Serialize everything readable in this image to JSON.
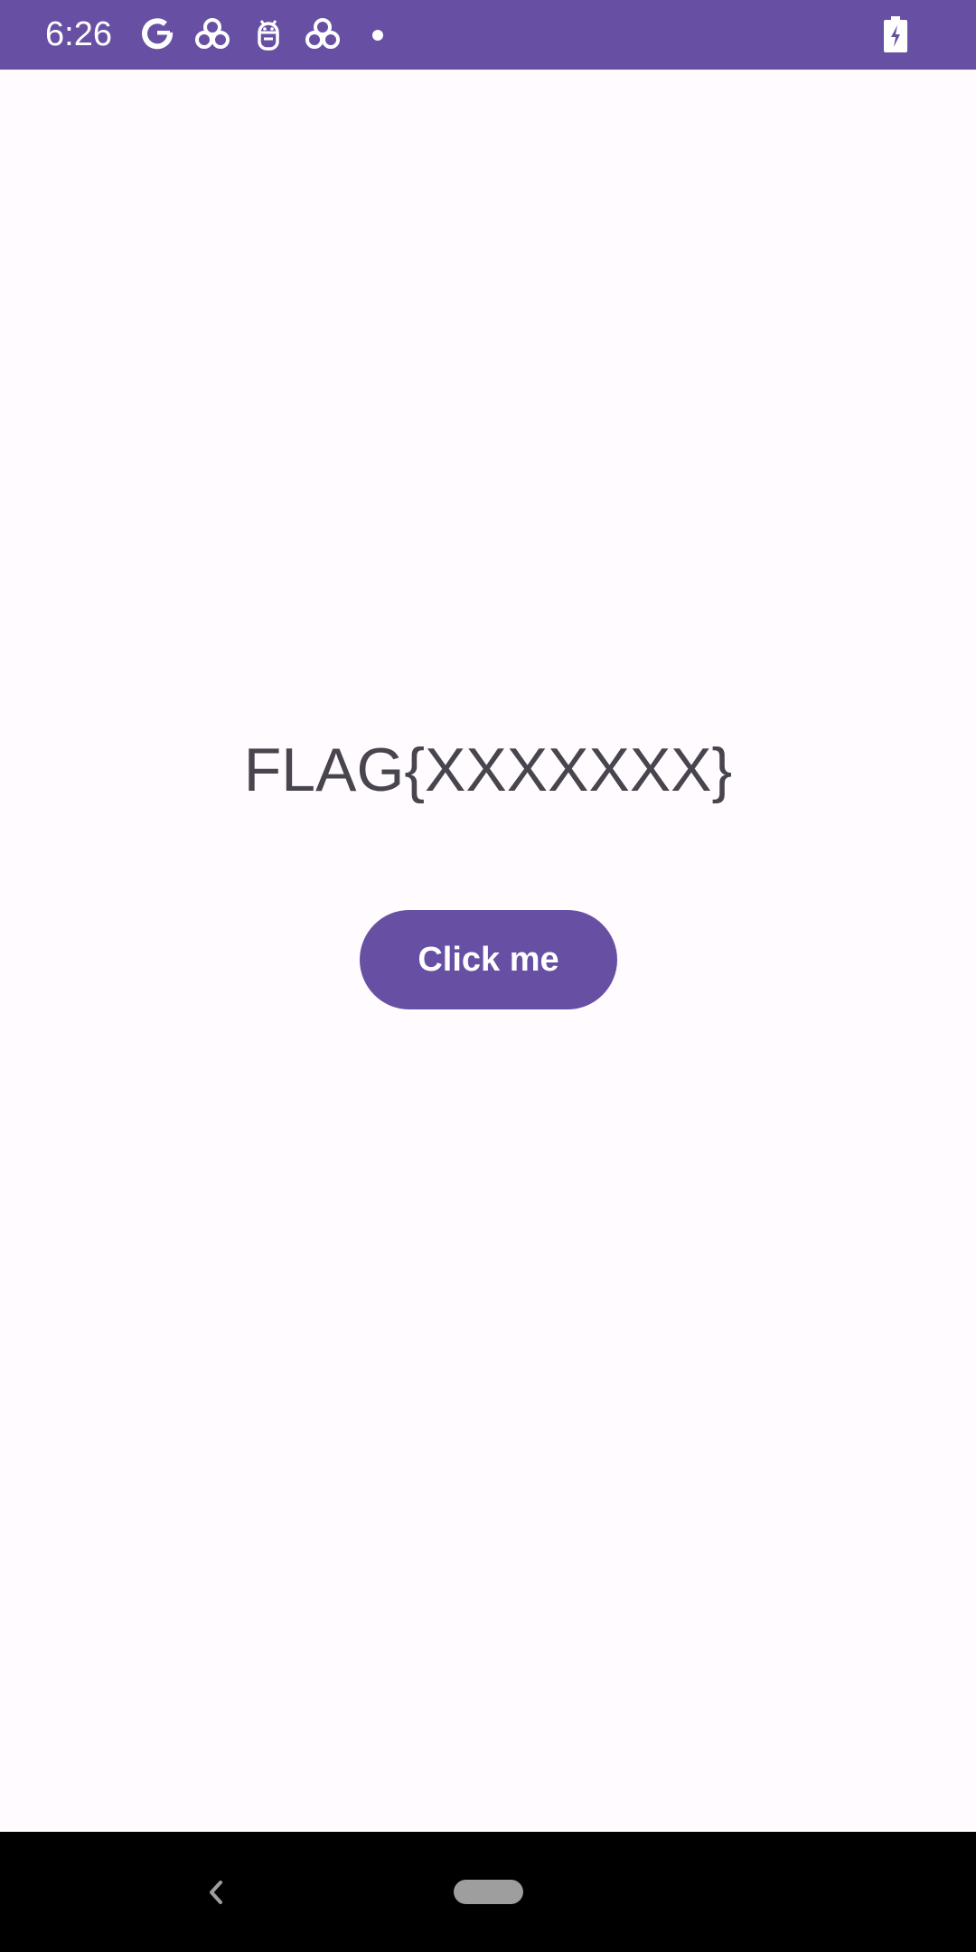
{
  "status_bar": {
    "time": "6:26",
    "icons": [
      "google-icon",
      "app-notification-icon",
      "android-robot-icon",
      "app-notification-icon",
      "more-notifications-dot-icon",
      "battery-charging-icon"
    ]
  },
  "main": {
    "flag_text": "FLAG{XXXXXXX}",
    "button_label": "Click me"
  },
  "colors": {
    "primary": "#6750a4",
    "background": "#fffbfe",
    "text": "#49454f",
    "nav_bar": "#000000"
  },
  "nav_bar": {
    "icons": [
      "back-icon",
      "home-pill-icon"
    ]
  }
}
